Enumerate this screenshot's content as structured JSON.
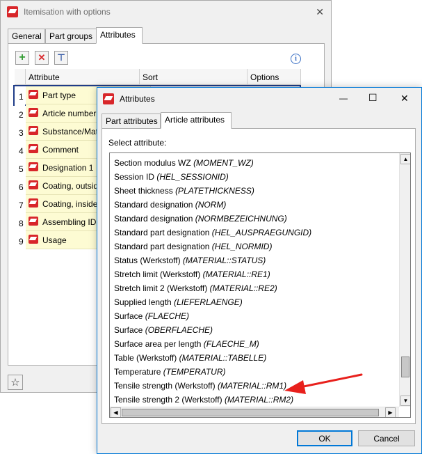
{
  "back_window": {
    "title": "Itemisation with options",
    "close_glyph": "✕",
    "tabs": [
      {
        "label": "General"
      },
      {
        "label": "Part groups"
      },
      {
        "label": "Attributes"
      }
    ],
    "toolbar": {
      "add_glyph": "+",
      "delete_glyph": "✕",
      "props_glyph": "⊤"
    },
    "info_glyph": "i",
    "grid": {
      "headers": [
        "Attribute",
        "Sort",
        "Options"
      ],
      "rows": [
        {
          "num": "1",
          "label": "Part type"
        },
        {
          "num": "2",
          "label": "Article number"
        },
        {
          "num": "3",
          "label": "Substance/Material"
        },
        {
          "num": "4",
          "label": "Comment"
        },
        {
          "num": "5",
          "label": "Designation 1"
        },
        {
          "num": "6",
          "label": "Coating, outside"
        },
        {
          "num": "7",
          "label": "Coating, inside"
        },
        {
          "num": "8",
          "label": "Assembling ID"
        },
        {
          "num": "9",
          "label": "Usage"
        }
      ]
    },
    "star_glyph": "☆"
  },
  "front_window": {
    "title": "Attributes",
    "controls": {
      "minimize": "—",
      "maximize": "☐",
      "close": "✕"
    },
    "tabs": [
      {
        "label": "Part attributes"
      },
      {
        "label": "Article attributes"
      }
    ],
    "select_label": "Select attribute:",
    "items": [
      {
        "name": "Section modulus WZ",
        "key": "(MOMENT_WZ)"
      },
      {
        "name": "Session ID",
        "key": "(HEL_SESSIONID)"
      },
      {
        "name": "Sheet thickness",
        "key": "(PLATETHICKNESS)"
      },
      {
        "name": "Standard designation",
        "key": "(NORM)"
      },
      {
        "name": "Standard designation",
        "key": "(NORMBEZEICHNUNG)"
      },
      {
        "name": "Standard part designation",
        "key": "(HEL_AUSPRAEGUNGID)"
      },
      {
        "name": "Standard part designation",
        "key": "(HEL_NORMID)"
      },
      {
        "name": "Status (Werkstoff)",
        "key": "(MATERIAL::STATUS)"
      },
      {
        "name": "Stretch limit (Werkstoff)",
        "key": "(MATERIAL::RE1)"
      },
      {
        "name": "Stretch limit 2 (Werkstoff)",
        "key": "(MATERIAL::RE2)"
      },
      {
        "name": "Supplied length",
        "key": "(LIEFERLAENGE)"
      },
      {
        "name": "Surface",
        "key": "(FLAECHE)"
      },
      {
        "name": "Surface",
        "key": "(OBERFLAECHE)"
      },
      {
        "name": "Surface area per length",
        "key": "(FLAECHE_M)"
      },
      {
        "name": "Table (Werkstoff)",
        "key": "(MATERIAL::TABELLE)"
      },
      {
        "name": "Temperature",
        "key": "(TEMPERATUR)"
      },
      {
        "name": "Tensile strength (Werkstoff)",
        "key": "(MATERIAL::RM1)"
      },
      {
        "name": "Tensile strength 2 (Werkstoff)",
        "key": "(MATERIAL::RM2)"
      }
    ],
    "ok_label": "OK",
    "cancel_label": "Cancel",
    "scroll_up": "▲",
    "scroll_down": "▼",
    "scroll_left": "◀",
    "scroll_right": "▶"
  },
  "colors": {
    "accent": "#0078d7",
    "annotation_arrow": "#e8201c",
    "row_highlight": "#fdfbd3"
  }
}
